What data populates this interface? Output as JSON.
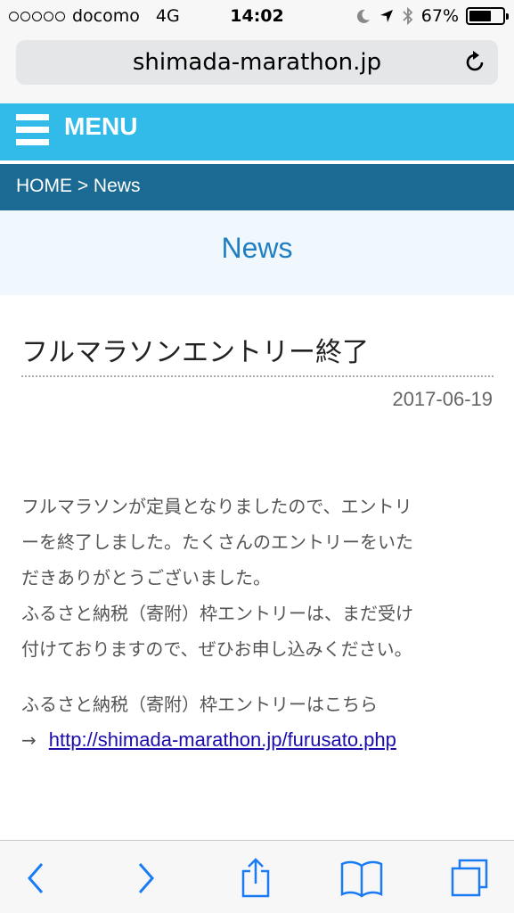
{
  "status_bar": {
    "carrier": "docomo",
    "network": "4G",
    "time": "14:02",
    "battery_text": "67%",
    "battery_level": 0.67
  },
  "browser": {
    "url": "shimada-marathon.jp"
  },
  "site": {
    "menu_label": "MENU",
    "breadcrumb": "HOME > News",
    "page_title": "News",
    "accent_color": "#32bbe9",
    "breadcrumb_color": "#1b6a93"
  },
  "article": {
    "title": "フルマラソンエントリー終了",
    "date": "2017-06-19",
    "body_lines": [
      "フルマラソンが定員となりましたので、エントリ",
      "ーを終了しました。たくさんのエントリーをいた",
      "だきありがとうございました。",
      "ふるさと納税（寄附）枠エントリーは、まだ受け",
      "付けておりますので、ぜひお申し込みください。"
    ],
    "link_intro": "ふるさと納税（寄附）枠エントリーはこちら",
    "link_arrow": "→",
    "link_text": "http://shimada-marathon.jp/furusato.php"
  }
}
